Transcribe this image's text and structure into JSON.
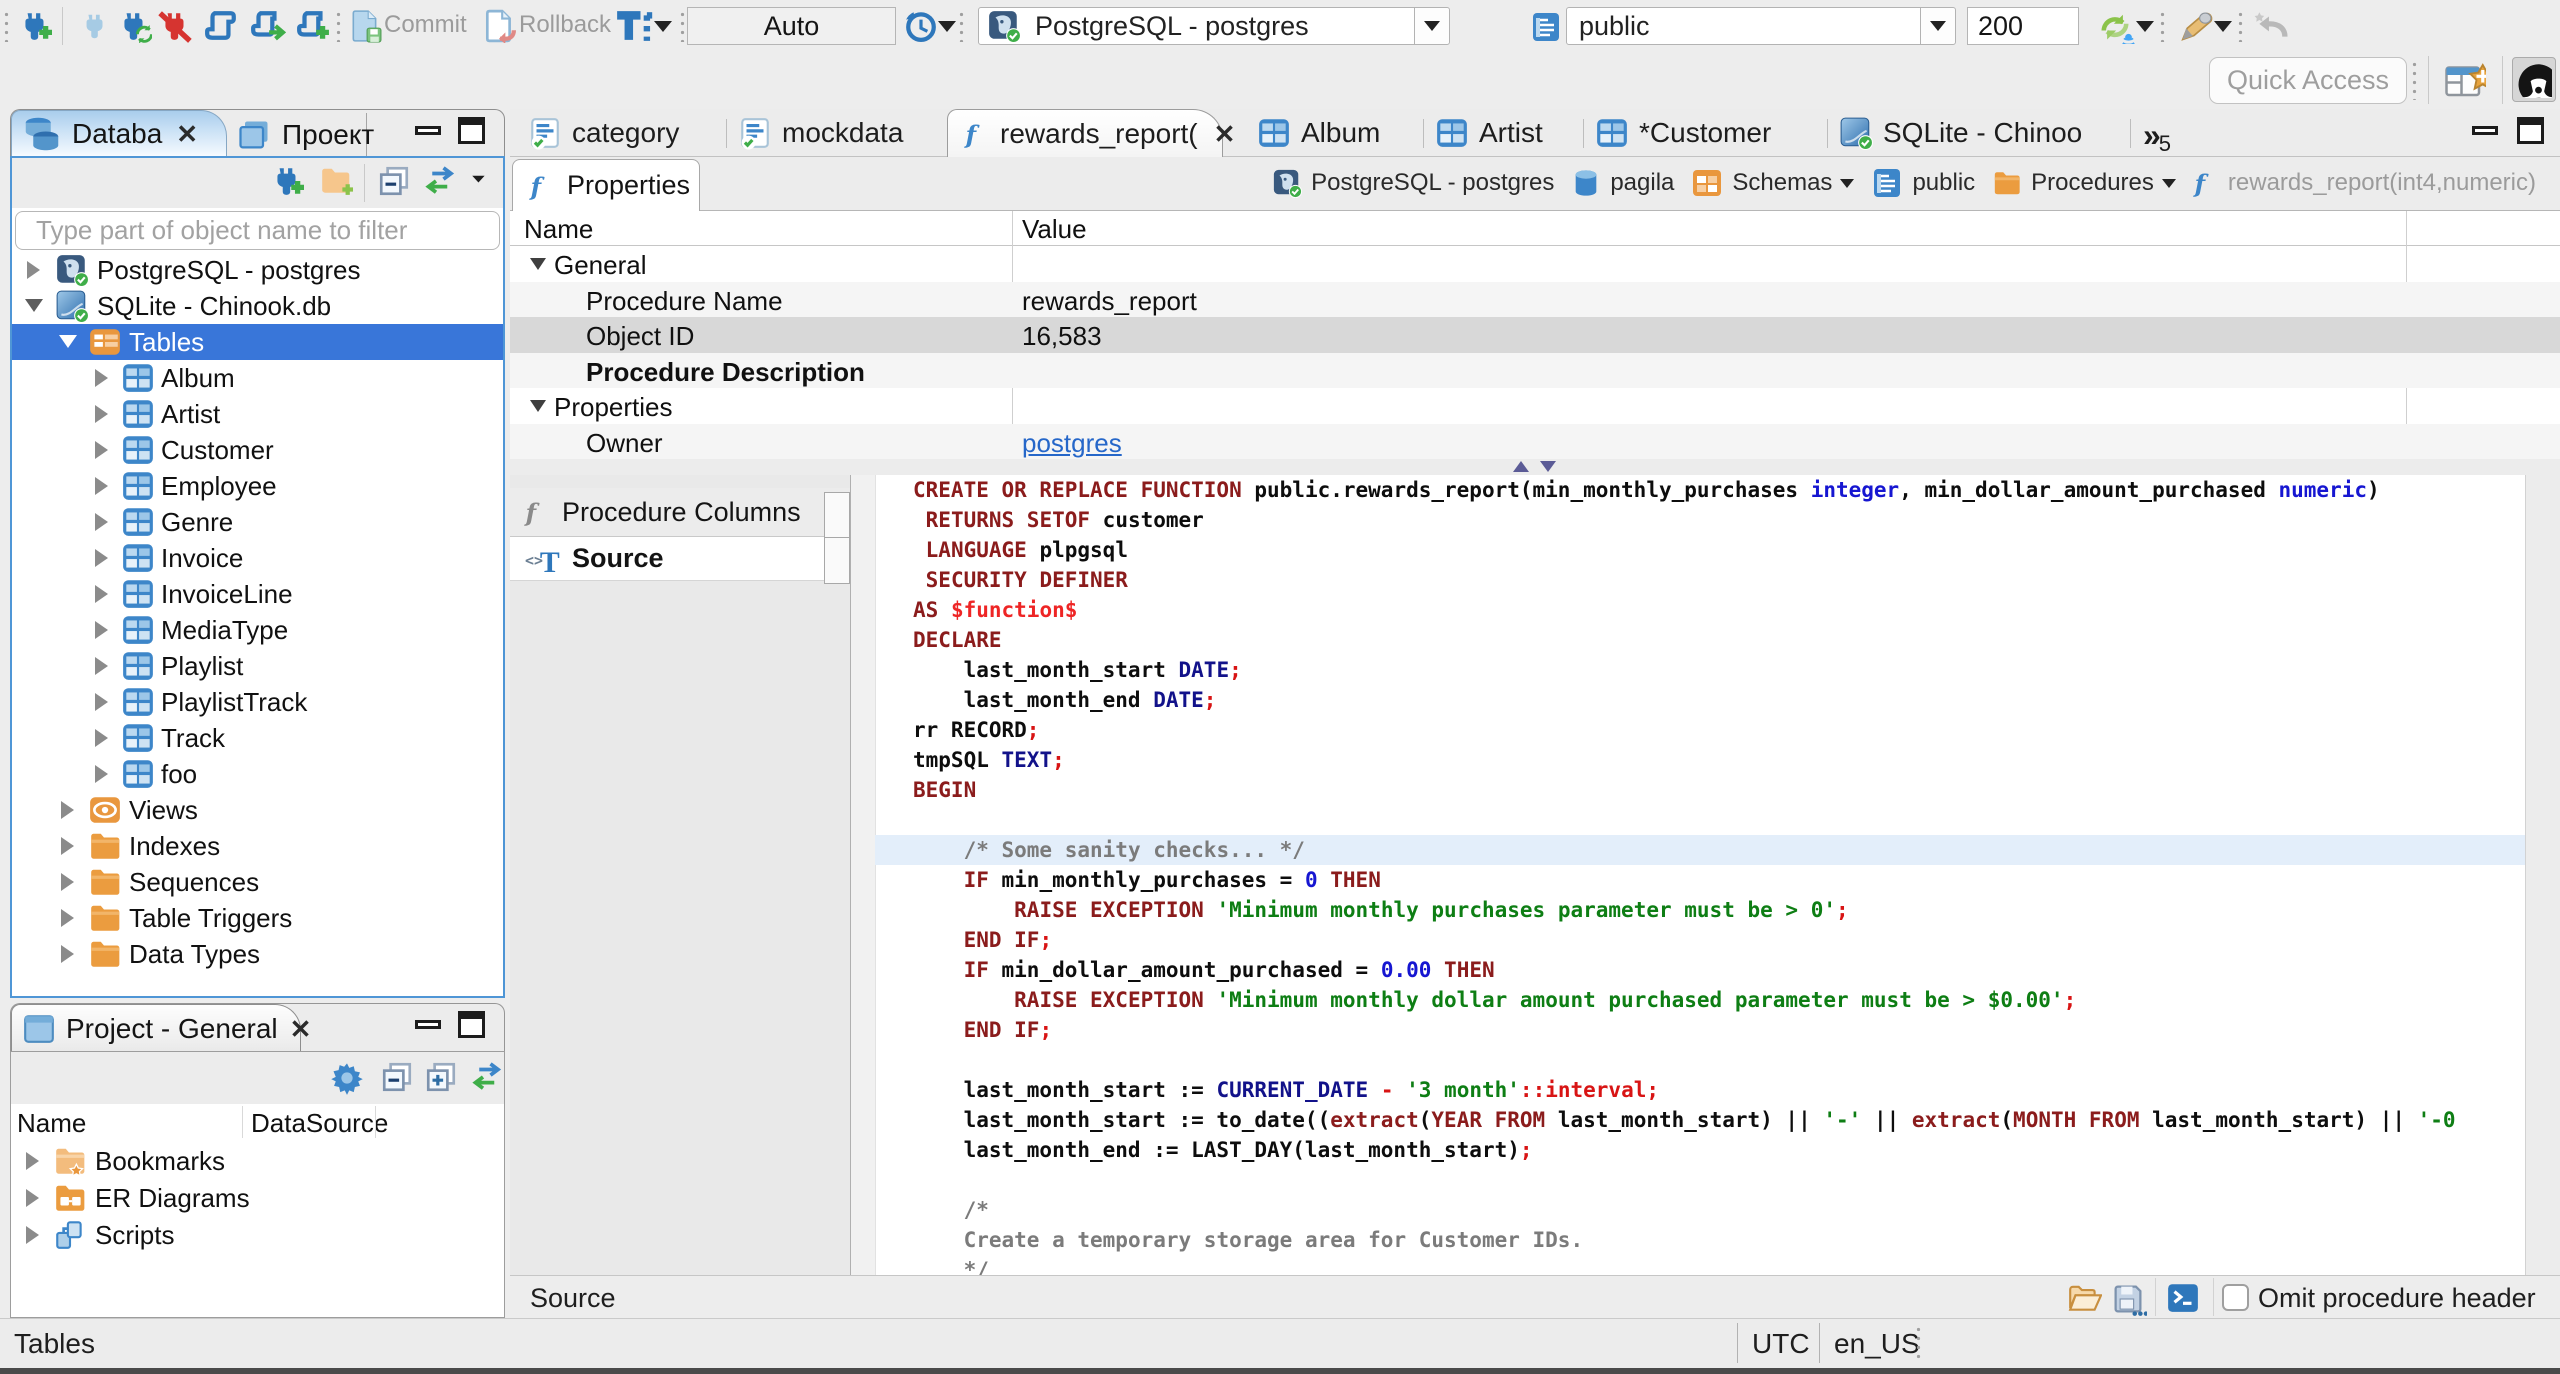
{
  "toolbar": {
    "commit_label": "Commit",
    "rollback_label": "Rollback",
    "auto_label": "Auto",
    "connection_combo_value": "PostgreSQL - postgres",
    "schema_combo_value": "public",
    "fetch_size_value": "200",
    "quick_access_placeholder": "Quick Access",
    "icons": [
      "new-connection-icon",
      "connect-icon",
      "reconnect-icon",
      "disconnect-icon",
      "sql-editor-icon",
      "open-sql-console-icon",
      "new-sql-editor-icon",
      "commit-icon",
      "rollback-icon",
      "transaction-mode-icon",
      "history-icon",
      "refresh-icon",
      "highlight-icon",
      "back-icon",
      "perspective-icon",
      "dbeaver-logo-icon"
    ]
  },
  "navigator": {
    "tab_label": "Databa",
    "tab2_label": "Проект",
    "filter_placeholder": "Type part of object name to filter",
    "tree": [
      {
        "label": "PostgreSQL - postgres",
        "icon": "postgres",
        "level": 0,
        "arrow": "r"
      },
      {
        "label": "SQLite - Chinook.db",
        "icon": "sqlite",
        "level": 0,
        "arrow": "d"
      },
      {
        "label": "Tables",
        "icon": "tables",
        "level": 1,
        "arrow": "d",
        "selected": true
      },
      {
        "label": "Album",
        "icon": "table",
        "level": 2,
        "arrow": "r"
      },
      {
        "label": "Artist",
        "icon": "table",
        "level": 2,
        "arrow": "r"
      },
      {
        "label": "Customer",
        "icon": "table",
        "level": 2,
        "arrow": "r"
      },
      {
        "label": "Employee",
        "icon": "table",
        "level": 2,
        "arrow": "r"
      },
      {
        "label": "Genre",
        "icon": "table",
        "level": 2,
        "arrow": "r"
      },
      {
        "label": "Invoice",
        "icon": "table",
        "level": 2,
        "arrow": "r"
      },
      {
        "label": "InvoiceLine",
        "icon": "table",
        "level": 2,
        "arrow": "r"
      },
      {
        "label": "MediaType",
        "icon": "table",
        "level": 2,
        "arrow": "r"
      },
      {
        "label": "Playlist",
        "icon": "table",
        "level": 2,
        "arrow": "r"
      },
      {
        "label": "PlaylistTrack",
        "icon": "table",
        "level": 2,
        "arrow": "r"
      },
      {
        "label": "Track",
        "icon": "table",
        "level": 2,
        "arrow": "r"
      },
      {
        "label": "foo",
        "icon": "table",
        "level": 2,
        "arrow": "r"
      },
      {
        "label": "Views",
        "icon": "views",
        "level": 1,
        "arrow": "r"
      },
      {
        "label": "Indexes",
        "icon": "folder",
        "level": 1,
        "arrow": "r"
      },
      {
        "label": "Sequences",
        "icon": "folder",
        "level": 1,
        "arrow": "r"
      },
      {
        "label": "Table Triggers",
        "icon": "folder",
        "level": 1,
        "arrow": "r"
      },
      {
        "label": "Data Types",
        "icon": "folder",
        "level": 1,
        "arrow": "r"
      }
    ]
  },
  "project": {
    "tab_label": "Project - General",
    "columns": [
      "Name",
      "DataSource"
    ],
    "rows": [
      {
        "label": "Bookmarks",
        "icon": "bookmarks",
        "arrow": "r"
      },
      {
        "label": "ER Diagrams",
        "icon": "erdiagrams",
        "arrow": "r"
      },
      {
        "label": "Scripts",
        "icon": "scripts",
        "arrow": "r"
      }
    ]
  },
  "statusbar": {
    "selection": "Tables",
    "timezone": "UTC",
    "locale": "en_US"
  },
  "editor": {
    "tabs": [
      {
        "label": "category",
        "icon": "script"
      },
      {
        "label": "mockdata",
        "icon": "script"
      },
      {
        "label": "rewards_report(",
        "icon": "function",
        "active": true,
        "close": true
      },
      {
        "label": "Album",
        "icon": "table"
      },
      {
        "label": "Artist",
        "icon": "table"
      },
      {
        "label": "*Customer",
        "icon": "table"
      },
      {
        "label": "SQLite - Chinoo",
        "icon": "sqlite"
      }
    ],
    "hidden_tabs_count": "5",
    "subtab_label": "Properties",
    "breadcrumb": [
      {
        "label": "PostgreSQL - postgres",
        "icon": "postgres"
      },
      {
        "label": "pagila",
        "icon": "dbcyl"
      },
      {
        "label": "Schemas",
        "icon": "schemas",
        "dropdown": true
      },
      {
        "label": "public",
        "icon": "schemadoc"
      },
      {
        "label": "Procedures",
        "icon": "folder",
        "dropdown": true
      },
      {
        "label": "rewards_report(int4,numeric)",
        "icon": "function",
        "muted": true
      }
    ],
    "properties_columns": [
      "Name",
      "Value"
    ],
    "properties_rows": [
      {
        "name": "General",
        "group": true
      },
      {
        "name": "Procedure Name",
        "value": "rewards_report",
        "stripe": true
      },
      {
        "name": "Object ID",
        "value": "16,583",
        "selected": true
      },
      {
        "name": "Procedure Description",
        "bold": true,
        "stripe": true
      },
      {
        "name": "Properties",
        "group": true
      },
      {
        "name": "Owner",
        "value": "postgres",
        "link": true,
        "stripe": true
      }
    ],
    "side_tabs": [
      {
        "label": "Procedure Columns",
        "icon": "function-gray"
      },
      {
        "label": "Source",
        "icon": "source",
        "active": true
      }
    ],
    "source_status_label": "Source",
    "omit_checkbox_label": "Omit procedure header",
    "code_lines": [
      [
        [
          "k",
          "CREATE OR REPLACE FUNCTION"
        ],
        [
          "p",
          " public.rewards_report(min_monthly_purchases "
        ],
        [
          "n",
          "integer"
        ],
        [
          "p",
          ", min_dollar_amount_purchased "
        ],
        [
          "n",
          "numeric"
        ],
        [
          "p",
          ")"
        ]
      ],
      [
        [
          "p",
          " "
        ],
        [
          "k",
          "RETURNS SETOF"
        ],
        [
          "p",
          " customer"
        ]
      ],
      [
        [
          "p",
          " "
        ],
        [
          "k",
          "LANGUAGE"
        ],
        [
          "p",
          " plpgsql"
        ]
      ],
      [
        [
          "p",
          " "
        ],
        [
          "k",
          "SECURITY DEFINER"
        ]
      ],
      [
        [
          "k",
          "AS"
        ],
        [
          "p",
          " "
        ],
        [
          "d",
          "$function$"
        ]
      ],
      [
        [
          "k",
          "DECLARE"
        ]
      ],
      [
        [
          "p",
          "    last_month_start "
        ],
        [
          "t",
          "DATE"
        ],
        [
          "r",
          ";"
        ]
      ],
      [
        [
          "p",
          "    last_month_end "
        ],
        [
          "t",
          "DATE"
        ],
        [
          "r",
          ";"
        ]
      ],
      [
        [
          "p",
          "rr RECORD"
        ],
        [
          "r",
          ";"
        ]
      ],
      [
        [
          "p",
          "tmpSQL "
        ],
        [
          "t",
          "TEXT"
        ],
        [
          "r",
          ";"
        ]
      ],
      [
        [
          "k",
          "BEGIN"
        ]
      ],
      [],
      [
        [
          "p",
          "    "
        ],
        [
          "c",
          "/* Some sanity checks... */"
        ]
      ],
      [
        [
          "p",
          "    "
        ],
        [
          "k",
          "IF"
        ],
        [
          "p",
          " min_monthly_purchases = "
        ],
        [
          "n",
          "0"
        ],
        [
          "p",
          " "
        ],
        [
          "k",
          "THEN"
        ]
      ],
      [
        [
          "p",
          "        "
        ],
        [
          "k",
          "RAISE EXCEPTION"
        ],
        [
          "p",
          " "
        ],
        [
          "s",
          "'Minimum monthly purchases parameter must be > 0'"
        ],
        [
          "r",
          ";"
        ]
      ],
      [
        [
          "p",
          "    "
        ],
        [
          "k",
          "END IF"
        ],
        [
          "r",
          ";"
        ]
      ],
      [
        [
          "p",
          "    "
        ],
        [
          "k",
          "IF"
        ],
        [
          "p",
          " min_dollar_amount_purchased = "
        ],
        [
          "n",
          "0.00"
        ],
        [
          "p",
          " "
        ],
        [
          "k",
          "THEN"
        ]
      ],
      [
        [
          "p",
          "        "
        ],
        [
          "k",
          "RAISE EXCEPTION"
        ],
        [
          "p",
          " "
        ],
        [
          "s",
          "'Minimum monthly dollar amount purchased parameter must be > $0.00'"
        ],
        [
          "r",
          ";"
        ]
      ],
      [
        [
          "p",
          "    "
        ],
        [
          "k",
          "END IF"
        ],
        [
          "r",
          ";"
        ]
      ],
      [],
      [
        [
          "p",
          "    last_month_start := "
        ],
        [
          "t",
          "CURRENT_DATE"
        ],
        [
          "p",
          " "
        ],
        [
          "r",
          "-"
        ],
        [
          "p",
          " "
        ],
        [
          "s",
          "'3 month'"
        ],
        [
          "r",
          "::interval;"
        ]
      ],
      [
        [
          "p",
          "    last_month_start := to_date(("
        ],
        [
          "k",
          "extract"
        ],
        [
          "p",
          "("
        ],
        [
          "k",
          "YEAR FROM"
        ],
        [
          "p",
          " last_month_start) || "
        ],
        [
          "s",
          "'-'"
        ],
        [
          "p",
          " || "
        ],
        [
          "k",
          "extract"
        ],
        [
          "p",
          "("
        ],
        [
          "k",
          "MONTH FROM"
        ],
        [
          "p",
          " last_month_start) || "
        ],
        [
          "s",
          "'-0"
        ]
      ],
      [
        [
          "p",
          "    last_month_end := LAST_DAY(last_month_start)"
        ],
        [
          "r",
          ";"
        ]
      ],
      [],
      [
        [
          "p",
          "    "
        ],
        [
          "c",
          "/*"
        ]
      ],
      [
        [
          "p",
          "    "
        ],
        [
          "c",
          "Create a temporary storage area for Customer IDs."
        ]
      ],
      [
        [
          "p",
          "    "
        ],
        [
          "c",
          "*/"
        ]
      ]
    ],
    "highlighted_line_index": 12
  }
}
